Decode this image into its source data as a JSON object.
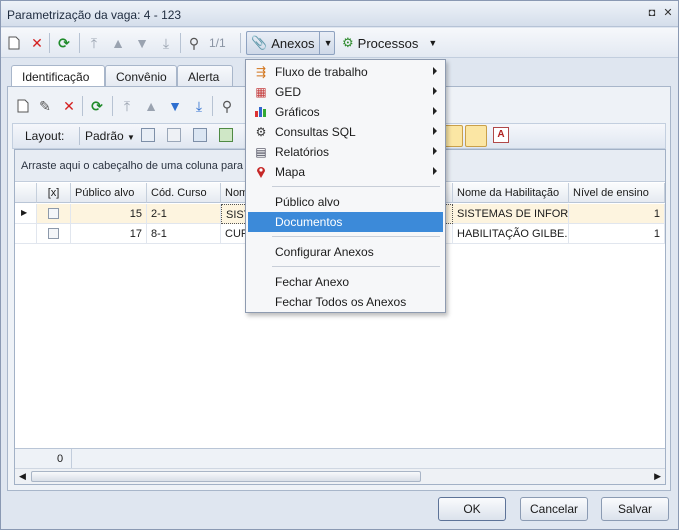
{
  "window": {
    "title": "Parametrização da vaga: 4 - 123"
  },
  "toolbar": {
    "pager": "1/1",
    "anexos_label": "Anexos",
    "processos_label": "Processos"
  },
  "tabs": [
    {
      "label": "Identificação"
    },
    {
      "label": "Convênio"
    },
    {
      "label": "Alerta"
    }
  ],
  "layout_bar": {
    "layout_label": "Layout:",
    "padrao_label": "Padrão"
  },
  "grid": {
    "group_hint": "Arraste aqui o cabeçalho de uma coluna para ag",
    "columns": [
      "[x]",
      "Público alvo",
      "Cód. Curso",
      "Nom",
      "Nome da Habilitação",
      "Nível de ensino"
    ],
    "rows": [
      {
        "publico": "15",
        "curso": "2-1",
        "nome": "SIST",
        "habilitacao": "SISTEMAS DE INFOR...",
        "nivel": "1"
      },
      {
        "publico": "17",
        "curso": "8-1",
        "nome": "CUR",
        "habilitacao": "HABILITAÇÃO GILBE...",
        "nivel": "1"
      }
    ],
    "footer_count": "0"
  },
  "menu": {
    "items": [
      {
        "label": "Fluxo de trabalho",
        "icon": "workflow-icon"
      },
      {
        "label": "GED",
        "icon": "ged-icon"
      },
      {
        "label": "Gráficos",
        "icon": "chart-icon"
      },
      {
        "label": "Consultas SQL",
        "icon": "sql-icon"
      },
      {
        "label": "Relatórios",
        "icon": "report-icon"
      },
      {
        "label": "Mapa",
        "icon": "map-pin-icon"
      },
      {
        "label": "Público alvo"
      },
      {
        "label": "Documentos"
      },
      {
        "label": "Configurar Anexos"
      },
      {
        "label": "Fechar Anexo"
      },
      {
        "label": "Fechar Todos os Anexos"
      }
    ]
  },
  "buttons": {
    "ok": "OK",
    "cancel": "Cancelar",
    "save": "Salvar"
  },
  "colors": {
    "highlight": "#3c8ad9",
    "selected_row": "#fdf4df"
  }
}
